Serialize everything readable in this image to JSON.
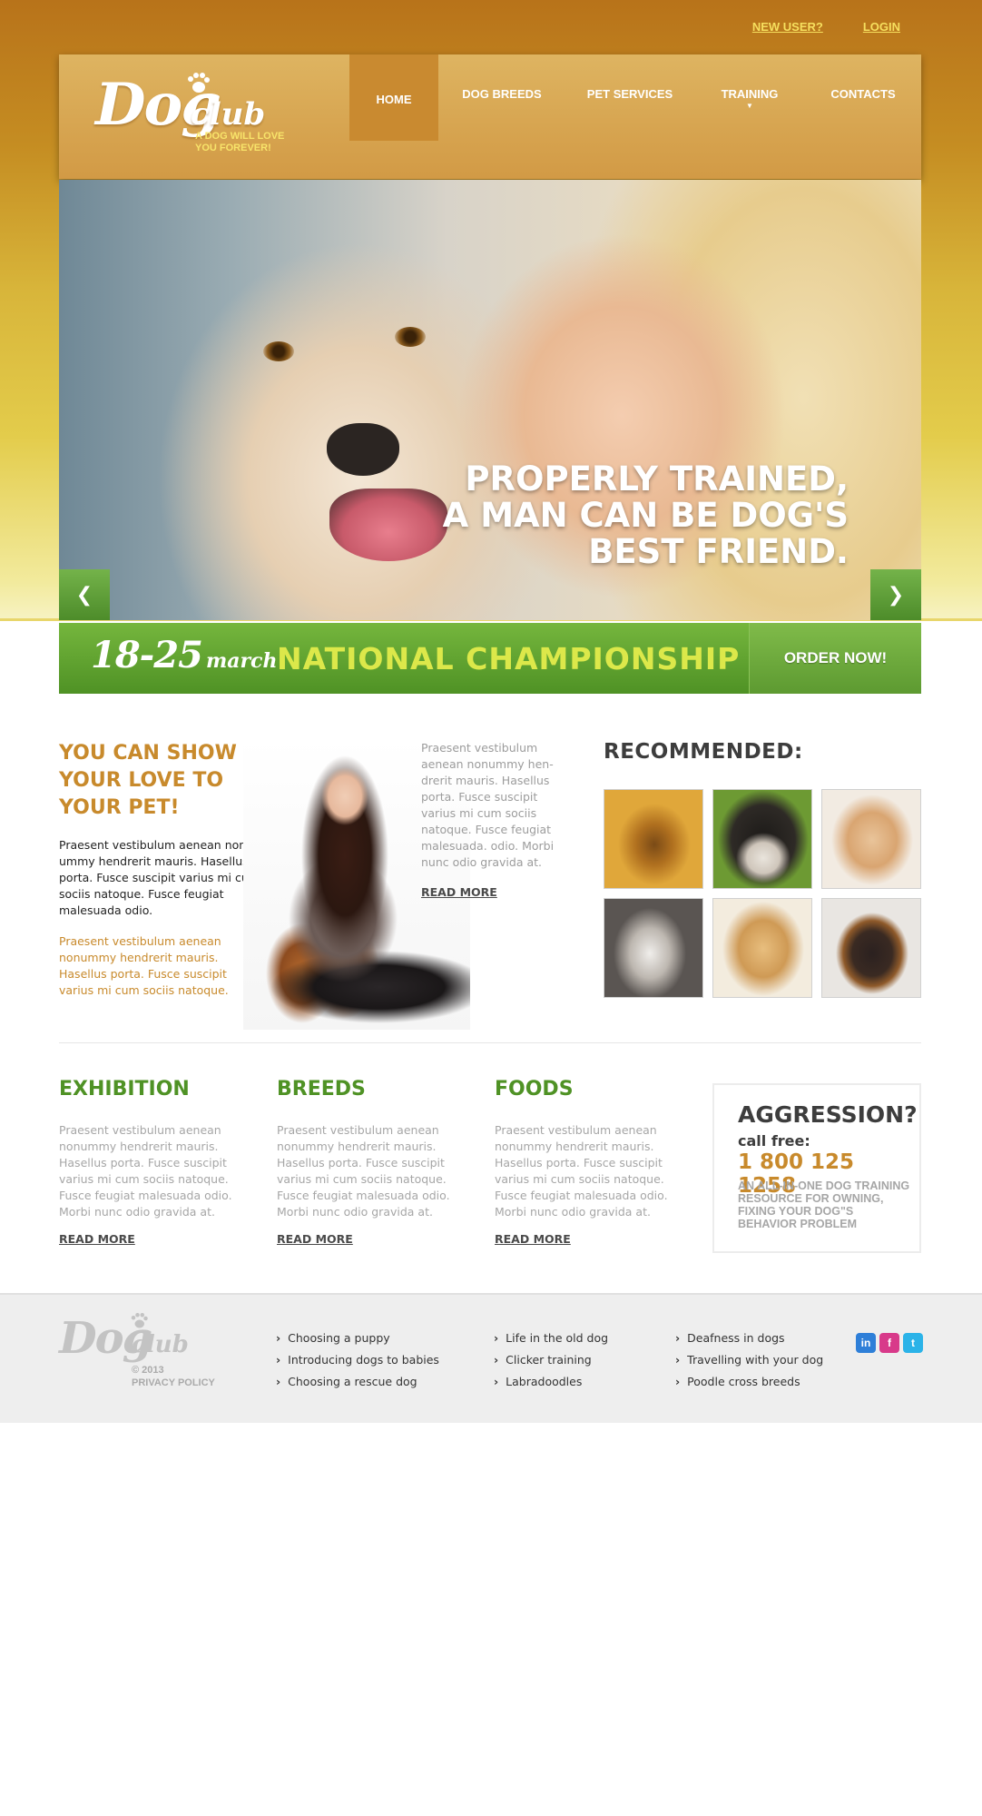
{
  "toplinks": {
    "new_user": "NEW USER?",
    "login": "LOGIN"
  },
  "logo": {
    "dog": "Dog",
    "club": "club",
    "tagline_1": "A DOG WILL LOVE",
    "tagline_2": "YOU FOREVER!"
  },
  "nav": {
    "items": [
      {
        "label": "HOME",
        "active": true
      },
      {
        "label": "DOG BREEDS"
      },
      {
        "label": "PET SERVICES"
      },
      {
        "label": "TRAINING",
        "has_dropdown": true
      },
      {
        "label": "CONTACTS"
      }
    ]
  },
  "hero": {
    "caption": "PROPERLY TRAINED, A MAN CAN BE DOG'S BEST FRIEND.",
    "prev_icon": "chevron-left-icon",
    "next_icon": "chevron-right-icon",
    "prev_glyph": "❮",
    "next_glyph": "❯"
  },
  "banner": {
    "date_big": "18-25",
    "date_small": "march",
    "title": "NATIONAL CHAMPIONSHIP",
    "order": "ORDER NOW!"
  },
  "love": {
    "title": "YOU CAN SHOW YOUR LOVE TO YOUR PET!",
    "p1": "Praesent vestibulum aenean non-ummy hendrerit mauris. Hasellus porta. Fusce suscipit varius mi cum sociis natoque. Fusce feugiat malesuada odio.",
    "p2": "Praesent vestibulum aenean nonummy hendrerit mauris. Hasellus porta. Fusce suscipit varius mi cum sociis natoque.",
    "side_text": "Praesent vestibulum aenean nonummy hen-drerit mauris. Hasellus porta. Fusce suscipit varius mi cum sociis natoque. Fusce feugiat malesuada. odio. Morbi nunc odio gravida at.",
    "read_more": "READ MORE"
  },
  "recommended": {
    "title": "RECOMMENDED:",
    "thumbs": [
      "yorkshire-terrier",
      "bernese-mountain-dog",
      "cocker-spaniel",
      "husky",
      "labrador-retriever",
      "rottweiler"
    ]
  },
  "columns": [
    {
      "title": "EXHIBITION",
      "text": "Praesent vestibulum aenean nonummy hendrerit mauris. Hasellus porta. Fusce suscipit varius mi cum sociis natoque. Fusce feugiat malesuada odio. Morbi nunc odio gravida at.",
      "read_more": "READ MORE"
    },
    {
      "title": "BREEDS",
      "text": "Praesent vestibulum aenean nonummy hendrerit mauris. Hasellus porta. Fusce suscipit varius mi cum sociis natoque. Fusce feugiat malesuada odio. Morbi nunc odio gravida at.",
      "read_more": "READ MORE"
    },
    {
      "title": "FOODS",
      "text": "Praesent vestibulum aenean nonummy hendrerit mauris. Hasellus porta. Fusce suscipit varius mi cum sociis natoque. Fusce feugiat malesuada odio. Morbi nunc odio gravida at.",
      "read_more": "READ MORE"
    }
  ],
  "aggression": {
    "title": "AGGRESSION?",
    "call": "call free:",
    "phone": "1 800 125 1258",
    "desc": "AN ALL-IN-ONE DOG TRAINING RESOURCE FOR OWNING, FIXING YOUR DOG\"S BEHAVIOR PROBLEM"
  },
  "footer": {
    "logo_dog": "Dog",
    "logo_club": "club",
    "copyright": "© 2013",
    "privacy": "PRIVACY POLICY",
    "list1": [
      "Choosing a puppy",
      "Introducing dogs to babies",
      "Choosing a rescue dog"
    ],
    "list2": [
      "Life in the old dog",
      "Clicker training",
      "Labradoodles"
    ],
    "list3": [
      "Deafness in dogs",
      "Travelling with your dog",
      "Poodle cross breeds"
    ],
    "social": [
      {
        "label": "in",
        "icon": "linkedin-icon",
        "color": "#2e7fd8"
      },
      {
        "label": "f",
        "icon": "facebook-icon",
        "color": "#d83a8a"
      },
      {
        "label": "t",
        "icon": "twitter-icon",
        "color": "#2bb3e8"
      }
    ]
  },
  "colors": {
    "accent_orange": "#c88a2c",
    "accent_green": "#4f9225",
    "banner_title": "#dce84a"
  }
}
